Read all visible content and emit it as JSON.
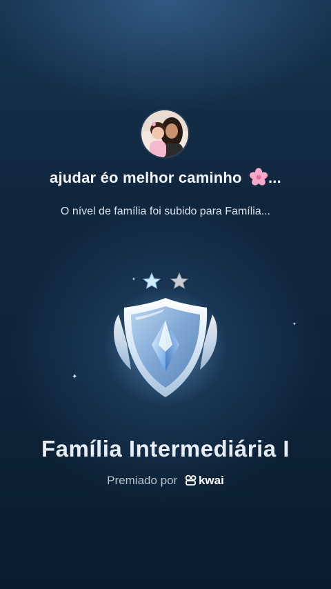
{
  "family": {
    "name": "ajudar éo melhor caminho",
    "ellipsis": "...",
    "avatar": "family-avatar-photo"
  },
  "notification": {
    "message": "O nível de família foi subido para Família..."
  },
  "level": {
    "title": "Família Intermediária I",
    "stars_filled": 1,
    "stars_total": 2
  },
  "awarded_by": {
    "label": "Premiado por",
    "brand": "kwai"
  },
  "icons": {
    "flower": "flower-emoji-icon",
    "badge": "shield-diamond-badge-icon",
    "brand": "kwai-logo-icon"
  },
  "colors": {
    "background_top": "#173451",
    "background_bottom": "#0b1c2e",
    "title_text": "#e7edf4",
    "subtitle_text": "#d9e1ea",
    "star_filled": "#bfe1ff",
    "star_empty": "#b9bec4"
  }
}
